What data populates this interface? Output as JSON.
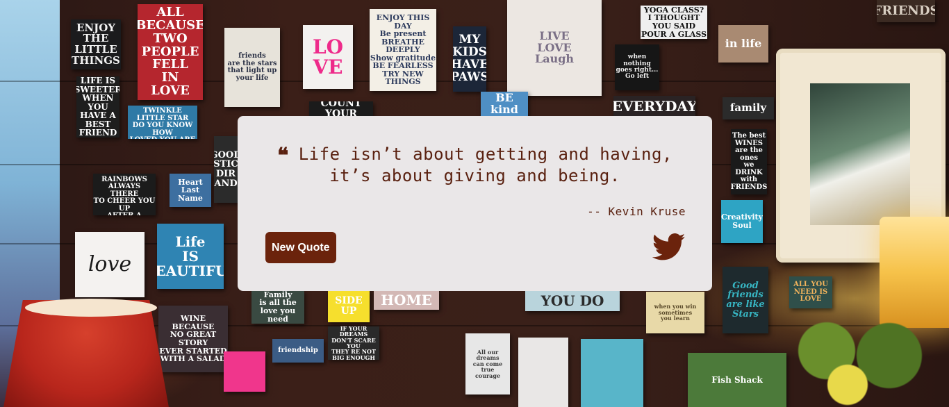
{
  "background": {
    "signs": [
      {
        "text": "ENJOY THE\nLITTLE\nTHINGS",
        "bg": "#1b1b1d",
        "fg": "#f2f2f2"
      },
      {
        "text": "ALL BECAUSE\nTWO PEOPLE\nFELL\nIN\nLOVE",
        "bg": "#b5262e",
        "fg": "#ffffff"
      },
      {
        "text": "friends\nare the stars\nthat light up\nyour life",
        "bg": "#e7e3da",
        "fg": "#2d3347"
      },
      {
        "text": "LO\nVE",
        "bg": "#f3f1ef",
        "fg": "#ee2a8a"
      },
      {
        "text": "ENJOY THIS DAY\nBe present\nBREATHE DEEPLY\nShow gratitude\nBE FEARLESS\nTRY NEW THINGS",
        "bg": "#f3efe6",
        "fg": "#2c3a5c"
      },
      {
        "text": "MY\nKIDS\nHAVE\nPAWS",
        "bg": "#1c2638",
        "fg": "#ffffff"
      },
      {
        "text": "LIVE\nLOVE\nLaugh",
        "bg": "#ece7e2",
        "fg": "#7a6f86"
      },
      {
        "text": "YOGA CLASS?\nI THOUGHT YOU SAID\nPOUR A GLASS",
        "bg": "#efefef",
        "fg": "#111111"
      },
      {
        "text": "when nothing\ngoes right...\nGo left",
        "bg": "#161616",
        "fg": "#f0f0f0"
      },
      {
        "text": "in life",
        "bg": "#a98a72",
        "fg": "#ffffff"
      },
      {
        "text": "FRIENDS",
        "bg": "#3b2a22",
        "fg": "#d9cfc3"
      },
      {
        "text": "LIFE IS\nSWEETER WHEN\nYOU HAVE A\nBEST FRIEND",
        "bg": "#1e1e1e",
        "fg": "#ffffff"
      },
      {
        "text": "TWINKLE TWINKLE\nLITTLE STAR\nDO YOU KNOW HOW\nLOVED YOU ARE",
        "bg": "#2f7aa6",
        "fg": "#ffffff"
      },
      {
        "text": "COUNT YOUR",
        "bg": "#1b1b1b",
        "fg": "#ffffff"
      },
      {
        "text": "BE\nkind",
        "bg": "#4f8fc4",
        "fg": "#ffffff"
      },
      {
        "text": "EVERYDAY",
        "bg": "#2a2324",
        "fg": "#ffffff"
      },
      {
        "text": "family",
        "bg": "#2b2b2b",
        "fg": "#ffffff"
      },
      {
        "text": "The best\nWINES\nare the ones\nwe DRINK\nwith\nFRIENDS",
        "bg": "#1a1a1a",
        "fg": "#ffffff"
      },
      {
        "text": "FRIENDS ARE LIKE\nRAINBOWS\nALWAYS THERE\nTO CHEER YOU UP\nAFTER A STORM",
        "bg": "#1b1b1b",
        "fg": "#ffffff"
      },
      {
        "text": "Heart\nLast Name",
        "bg": "#3d6fa0",
        "fg": "#ffffff"
      },
      {
        "text": "GOOD\nSTIC\nDIR\nAND",
        "bg": "#2b2b2b",
        "fg": "#ffffff"
      },
      {
        "text": "Creativity\nSoul",
        "bg": "#2ea4c4",
        "fg": "#ffffff"
      },
      {
        "text": "love",
        "bg": "#f4f2f0",
        "fg": "#1a1a1a"
      },
      {
        "text": "Life\nIS\nBEAUTIFUL",
        "bg": "#2f84b3",
        "fg": "#ffffff"
      },
      {
        "text": "Good\nfriends\nare like\nStars",
        "bg": "#1e2a2e",
        "fg": "#37b5c2"
      },
      {
        "text": "ALL YOU\nNEED IS\nLOVE",
        "bg": "#2f4f4a",
        "fg": "#f1b35c"
      },
      {
        "text": "WINE\nBECAUSE\nNO GREAT STORY\nEVER STARTED\nWITH A SALAD",
        "bg": "#3a2e33",
        "fg": "#ffffff"
      },
      {
        "text": "Family\nis all the\nlove you need",
        "bg": "#3a4a42",
        "fg": "#ffffff"
      },
      {
        "text": "SIDE\nUP",
        "bg": "#f6df2d",
        "fg": "#ffffff"
      },
      {
        "text": "HOME",
        "bg": "#d3b8b5",
        "fg": "#ffffff"
      },
      {
        "text": "YOU DO",
        "bg": "#b9d4dc",
        "fg": "#2b2b2b"
      },
      {
        "text": "friendship",
        "bg": "#3b5c85",
        "fg": "#ffffff"
      },
      {
        "text": "IF YOUR DREAMS\nDON'T SCARE YOU\nTHEY RE NOT BIG ENOUGH",
        "bg": "#2a2a2a",
        "fg": "#ffffff"
      },
      {
        "text": "All our dreams\ncan come true\ncourage",
        "bg": "#e7e7e7",
        "fg": "#3b3b3b"
      },
      {
        "text": "Fish Shack",
        "bg": "#4c7a3a",
        "fg": "#ffffff"
      },
      {
        "text": "when you win\nsometimes\nyou learn",
        "bg": "#e8d9a8",
        "fg": "#5a4a2a"
      },
      {
        "text": "",
        "bg": "#f0368c",
        "fg": "#ffffff"
      },
      {
        "text": "",
        "bg": "#e9e7e6",
        "fg": "#222222"
      },
      {
        "text": "",
        "bg": "#58b5c9",
        "fg": "#ffffff"
      }
    ]
  },
  "quote": {
    "text": "Life isn’t about getting and having, it’s about giving and being.",
    "author": "-- Kevin Kruse",
    "icon": "quote-left-icon"
  },
  "actions": {
    "new_quote_label": "New Quote",
    "tweet_icon": "twitter-icon",
    "accent_color": "#6b230c"
  }
}
